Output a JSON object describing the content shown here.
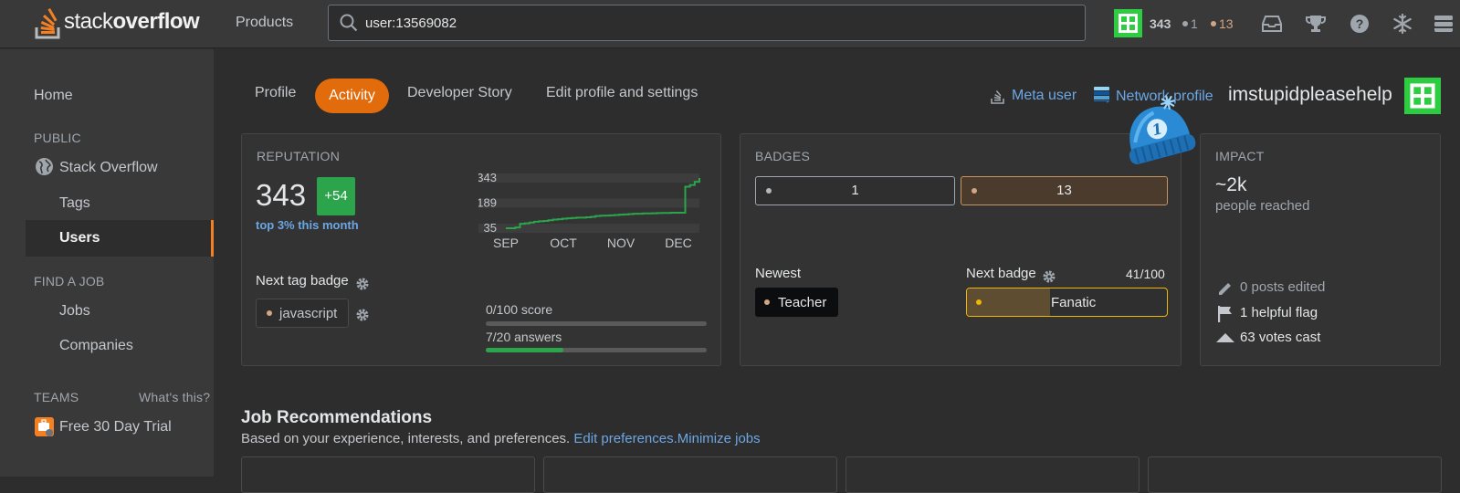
{
  "topbar": {
    "logo_light": "stack",
    "logo_bold": "overflow",
    "products": "Products",
    "search_value": "user:13569082",
    "reputation": "343",
    "silver_count": "1",
    "bronze_count": "13"
  },
  "sidebar": {
    "home": "Home",
    "public": "PUBLIC",
    "stack_overflow": "Stack Overflow",
    "tags": "Tags",
    "users": "Users",
    "find_a_job": "FIND A JOB",
    "jobs": "Jobs",
    "companies": "Companies",
    "teams": "TEAMS",
    "whats_this": "What's this?",
    "free_trial": "Free 30 Day Trial"
  },
  "tabs": {
    "profile": "Profile",
    "activity": "Activity",
    "developer_story": "Developer Story",
    "edit": "Edit profile and settings"
  },
  "profile_links": {
    "meta_user": "Meta user",
    "network_profile": "Network profile",
    "username": "imstupidpleasehelp",
    "hat_number": "1"
  },
  "reputation": {
    "title": "REPUTATION",
    "value": "343",
    "change": "+54",
    "rank": "top 3% this month",
    "next_tag_badge": "Next tag badge",
    "tag": "javascript",
    "score_label": "0/100 score",
    "score_progress": 0.0,
    "answers_label": "7/20 answers",
    "answers_progress": 0.35
  },
  "chart_data": {
    "type": "line",
    "y_ticks": [
      "343",
      "189",
      "35"
    ],
    "x_ticks": [
      "SEP",
      "OCT",
      "NOV",
      "DEC"
    ],
    "ylim": [
      35,
      343
    ],
    "series": [
      {
        "values": [
          35,
          35,
          40,
          62,
          65,
          70,
          75,
          78,
          80,
          84,
          88,
          90,
          94,
          96,
          98,
          100,
          100,
          102,
          105,
          110,
          112,
          113,
          114,
          116,
          118,
          120,
          122,
          124,
          124,
          126,
          126,
          127,
          128,
          129,
          129,
          130,
          130,
          130,
          290,
          300,
          320,
          343
        ]
      }
    ]
  },
  "badges": {
    "title": "BADGES",
    "silver": "1",
    "bronze": "13",
    "newest_label": "Newest",
    "newest_badge": "Teacher",
    "next_badge_label": "Next badge",
    "next_progress_text": "41/100",
    "next_badge": "Fanatic",
    "next_progress": 0.41,
    "colors": {
      "silver": "#b4b8bc",
      "bronze": "#d1a684",
      "gold": "#f1b600"
    }
  },
  "impact": {
    "title": "IMPACT",
    "reached": "~2k",
    "reached_label": "people reached",
    "posts_edited": "0 posts edited",
    "helpful_flag": "1 helpful flag",
    "votes_cast": "63 votes cast"
  },
  "jobs": {
    "title": "Job Recommendations",
    "subtitle": "Based on your experience, interests, and preferences.",
    "edit_prefs": "Edit preferences.",
    "minimize": "Minimize jobs"
  }
}
